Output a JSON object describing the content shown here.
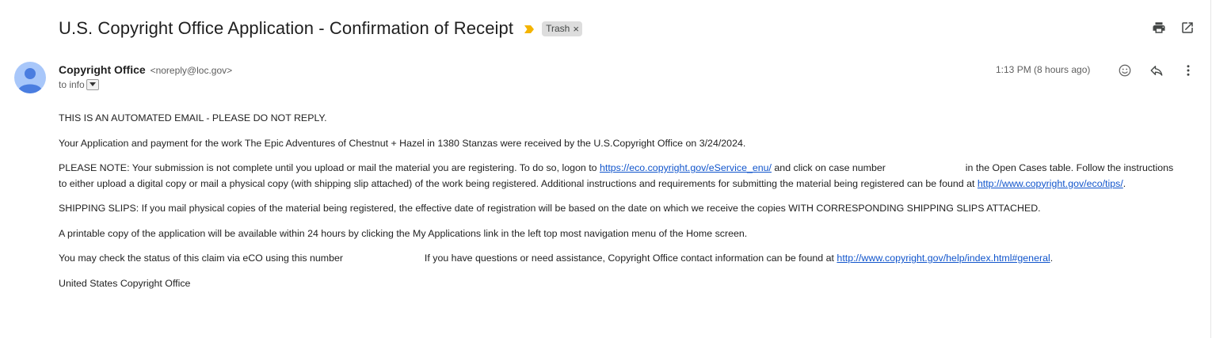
{
  "subject": "U.S. Copyright Office Application - Confirmation of Receipt",
  "label": {
    "text": "Trash",
    "remove": "×"
  },
  "sender": {
    "name": "Copyright Office",
    "email": "<noreply@loc.gov>",
    "to": "to info"
  },
  "time": "1:13 PM (8 hours ago)",
  "icons": {
    "print": "print-icon",
    "open_new": "open-in-new-window-icon",
    "emoji": "emoji-reaction-icon",
    "reply": "reply-icon",
    "more": "more-vertical-icon",
    "importance": "importance-marker-icon",
    "avatar": "person-avatar-icon",
    "dropdown": "dropdown-arrow-icon"
  },
  "colors": {
    "importance": "#f4b400",
    "link": "#1155cc",
    "avatar_bg": "#a8c7fa",
    "avatar_fg": "#4a7de0"
  },
  "body": {
    "p1": "THIS IS AN AUTOMATED EMAIL - PLEASE DO NOT REPLY.",
    "p2": "Your Application and payment for the work The Epic Adventures of Chestnut + Hazel in 1380 Stanzas were received by the U.S.Copyright Office on 3/24/2024.",
    "p3_a": "PLEASE NOTE:  Your submission is not complete until you upload or mail the material you are registering. To do so, logon to ",
    "p3_link1": "https://eco.copyright.gov/eService_enu/",
    "p3_b": " and click on case number ",
    "p3_c": " in the Open Cases table. Follow the instructions to either upload a digital copy or mail a physical copy (with shipping slip attached) of the work being registered. Additional instructions and requirements for submitting the material being registered can be found at ",
    "p3_link2": "http://www.copyright.gov/eco/tips/",
    "p3_d": ".",
    "p4": "SHIPPING SLIPS:  If you mail physical copies of the material being registered, the effective date of registration will be based on the date on which we receive the copies WITH CORRESPONDING SHIPPING SLIPS ATTACHED.",
    "p5": "A printable copy of the application will be available within 24 hours by clicking the My Applications link in the left top most navigation menu of the Home screen.",
    "p6_a": "You may check the status of this claim via eCO using this number ",
    "p6_b": " If you have questions or need assistance, Copyright Office contact information can be found at ",
    "p6_link": "http://www.copyright.gov/help/index.html#general",
    "p6_c": ".",
    "p7": "United States Copyright Office"
  }
}
